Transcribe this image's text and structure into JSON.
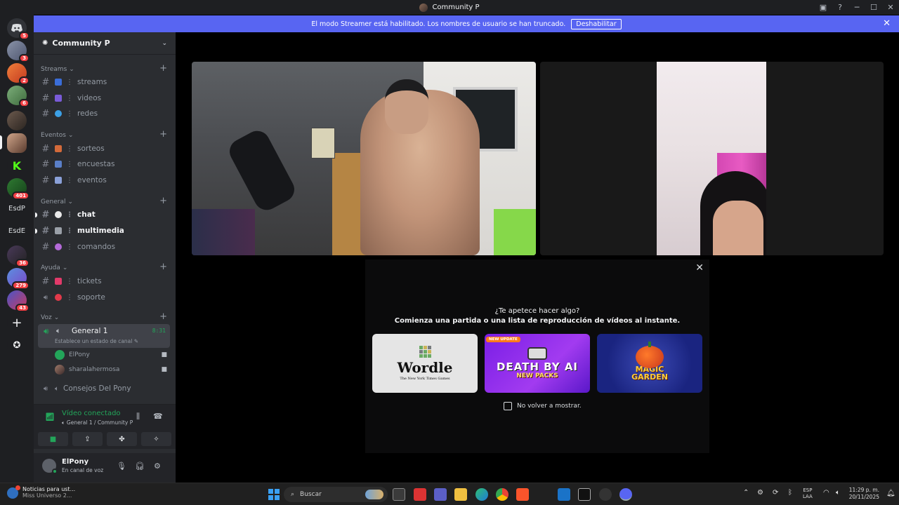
{
  "window": {
    "title": "Community P"
  },
  "banner": {
    "text": "El modo Streamer está habilitado. Los nombres de usuario se han truncado.",
    "button": "Deshabilitar"
  },
  "rail": {
    "badges": [
      "5",
      "3",
      "2",
      "6",
      "401",
      "36",
      "279",
      "43"
    ],
    "text_servers": [
      "EsdP",
      "EsdE"
    ]
  },
  "server": {
    "name": "Community P"
  },
  "categories": {
    "streams": "Streams",
    "eventos": "Eventos",
    "general": "General",
    "ayuda": "Ayuda",
    "voz": "Voz"
  },
  "channels": {
    "streams": "streams",
    "videos": "videos",
    "redes": "redes",
    "sorteos": "sorteos",
    "encuestas": "encuestas",
    "eventos": "eventos",
    "chat": "chat",
    "multimedia": "multimedia",
    "comandos": "comandos",
    "tickets": "tickets",
    "soporte": "soporte"
  },
  "voice": {
    "active_channel": "General 1",
    "timer": "8:31",
    "status_prompt": "Establece un estado de canal",
    "users": [
      "ElPony",
      "sharalahermosa"
    ],
    "other_channel": "Consejos Del Pony"
  },
  "connection": {
    "title": "Vídeo conectado",
    "subtitle": "General 1 / Community P"
  },
  "user": {
    "name": "ElPony",
    "status": "En canal de voz"
  },
  "activity": {
    "question": "¿Te apetece hacer algo?",
    "prompt": "Comienza una partida o una lista de reproducción de vídeos al instante.",
    "games": {
      "wordle_title": "Wordle",
      "wordle_sub": "The New York Times Games",
      "death_badge": "NEW UPDATE",
      "death_title": "DEATH BY AI",
      "death_sub": "NEW PACKS",
      "magic_l1": "MAGIC",
      "magic_l2": "GARDEN"
    },
    "checkbox_label": "No volver a mostrar."
  },
  "taskbar": {
    "weather_l1": "Noticias para ust...",
    "weather_l2": "Miss Universo 2...",
    "search_placeholder": "Buscar",
    "lang_1": "ESP",
    "lang_2": "LAA",
    "time": "11:29 p. m.",
    "date": "20/11/2025"
  },
  "colors": {
    "accent": "#5865f2",
    "online": "#23a55a",
    "danger": "#f23f43",
    "sidebar": "#2b2d31",
    "rail": "#1e1f22"
  }
}
